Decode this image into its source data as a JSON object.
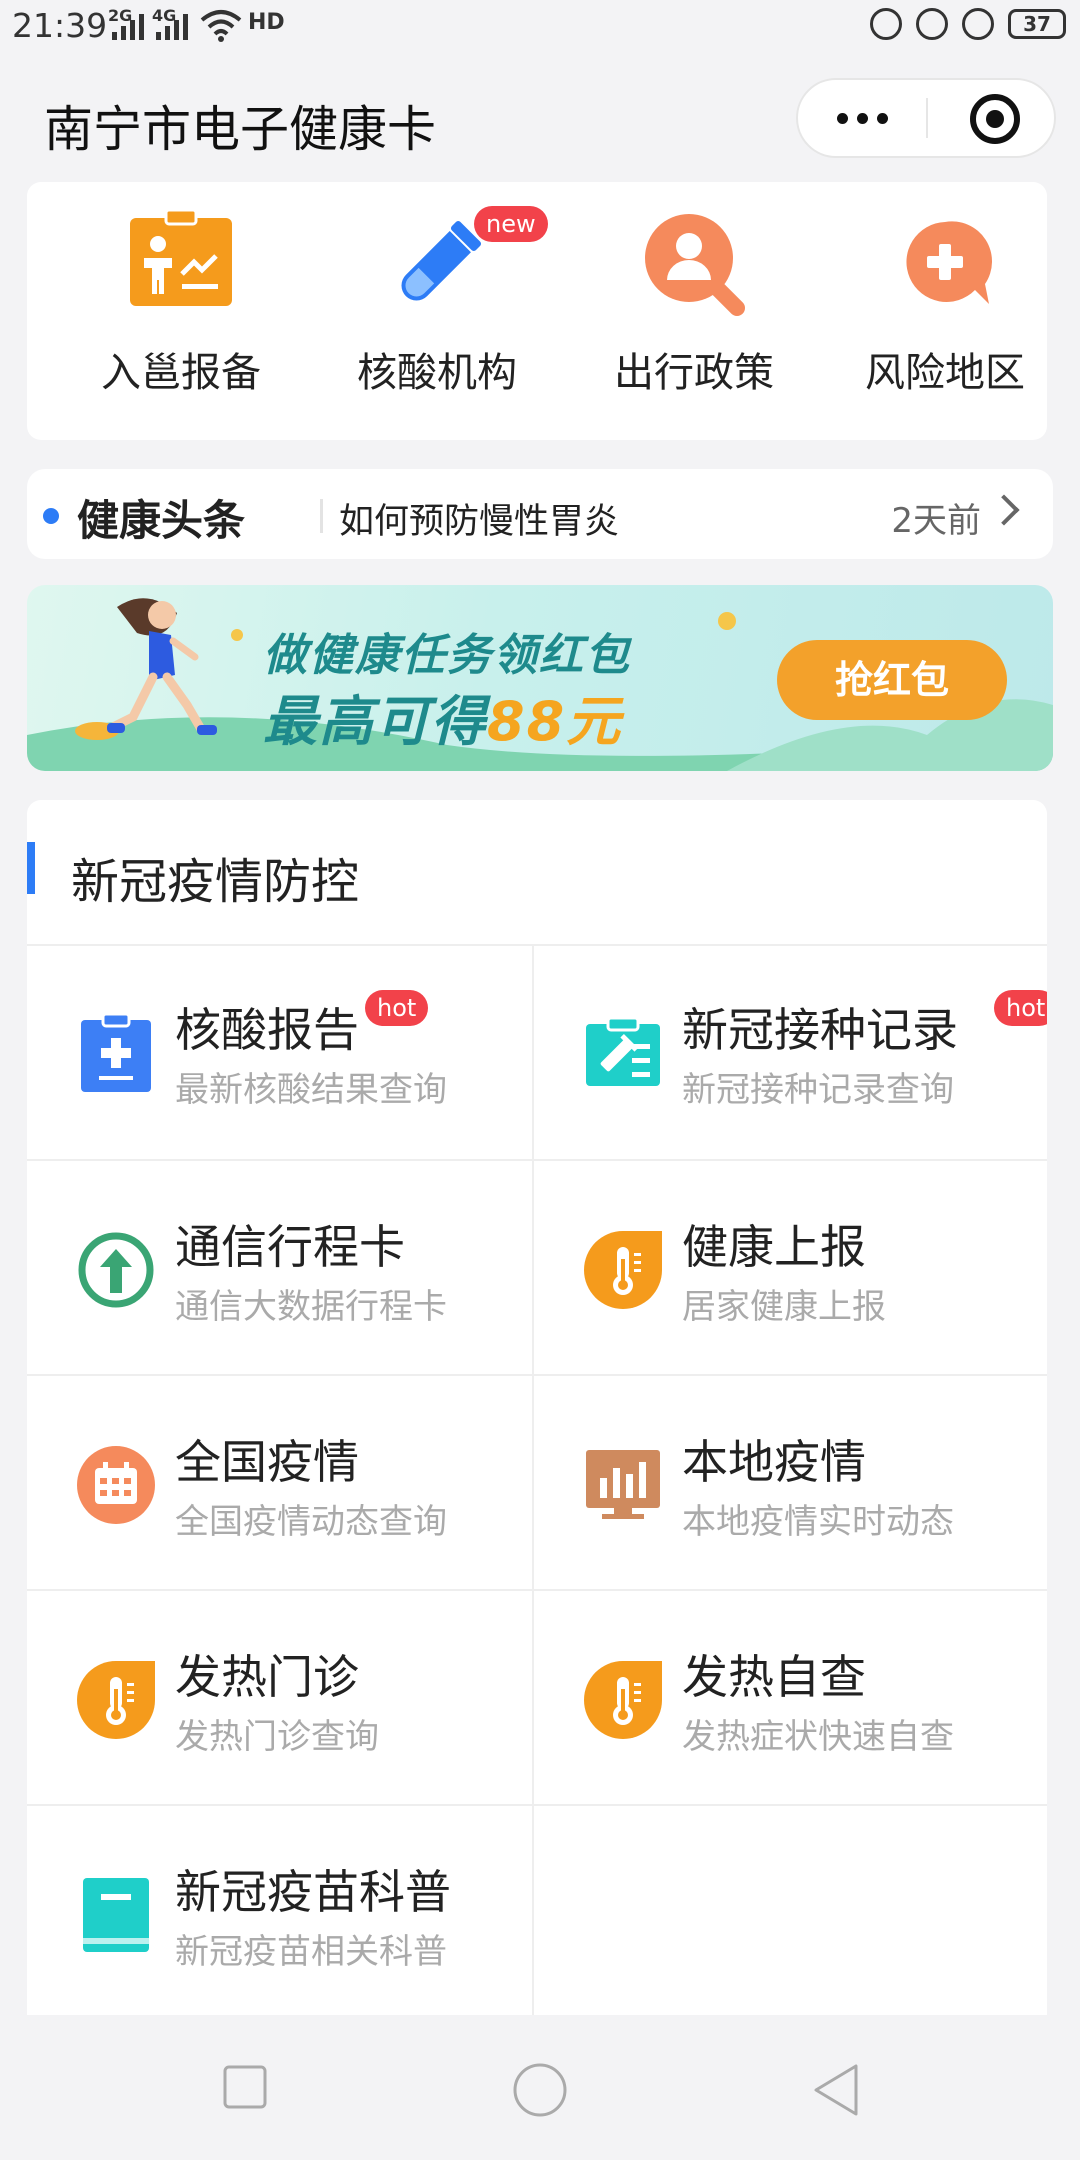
{
  "status": {
    "time": "21:39",
    "net1": "2G",
    "net2": "4G",
    "hd": "HD",
    "battery": "37"
  },
  "header": {
    "title": "南宁市电子健康卡"
  },
  "quick": [
    {
      "label": "入邕报备",
      "icon": "report-icon"
    },
    {
      "label": "核酸机构",
      "icon": "test-tube-icon",
      "badge": "new"
    },
    {
      "label": "出行政策",
      "icon": "policy-search-icon"
    },
    {
      "label": "风险地区",
      "icon": "risk-area-icon"
    }
  ],
  "news": {
    "title": "健康头条",
    "text": "如何预防慢性胃炎",
    "time": "2天前"
  },
  "banner": {
    "line1": "做健康任务领红包",
    "line2_prefix": "最高可得",
    "amount": "88元",
    "button": "抢红包"
  },
  "covid": {
    "title": "新冠疫情防控",
    "items": [
      {
        "title": "核酸报告",
        "sub": "最新核酸结果查询",
        "badge": "hot",
        "icon": "nucleic-report-icon"
      },
      {
        "title": "新冠接种记录",
        "sub": "新冠接种记录查询",
        "badge": "hot",
        "icon": "vaccine-record-icon"
      },
      {
        "title": "通信行程卡",
        "sub": "通信大数据行程卡",
        "icon": "itinerary-card-icon"
      },
      {
        "title": "健康上报",
        "sub": "居家健康上报",
        "icon": "thermometer-icon"
      },
      {
        "title": "全国疫情",
        "sub": "全国疫情动态查询",
        "icon": "calendar-icon"
      },
      {
        "title": "本地疫情",
        "sub": "本地疫情实时动态",
        "icon": "bar-chart-icon"
      },
      {
        "title": "发热门诊",
        "sub": "发热门诊查询",
        "icon": "thermometer-icon"
      },
      {
        "title": "发热自查",
        "sub": "发热症状快速自查",
        "icon": "thermometer-icon"
      },
      {
        "title": "新冠疫苗科普",
        "sub": "新冠疫苗相关科普",
        "icon": "book-icon"
      }
    ]
  },
  "colors": {
    "accent": "#2d7cf6",
    "badge": "#f2424a",
    "orange": "#f3a12b"
  }
}
